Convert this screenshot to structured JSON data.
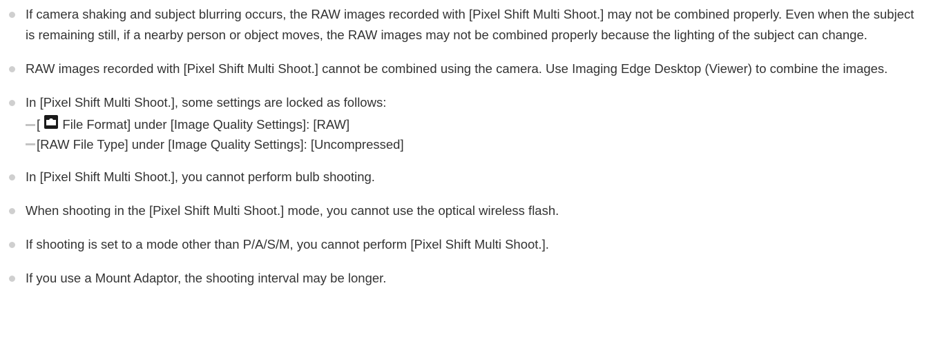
{
  "notes": [
    {
      "text": "If camera shaking and subject blurring occurs, the RAW images recorded with [Pixel Shift Multi Shoot.] may not be combined properly. Even when the subject is remaining still, if a nearby person or object moves, the RAW images may not be combined properly because the lighting of the subject can change."
    },
    {
      "text": "RAW images recorded with [Pixel Shift Multi Shoot.] cannot be combined using the camera. Use Imaging Edge Desktop (Viewer) to combine the images."
    },
    {
      "text": "In [Pixel Shift Multi Shoot.], some settings are locked as follows:",
      "subitems": [
        {
          "prefix": "[",
          "icon": "camera-icon",
          "text": "File Format] under [Image Quality Settings]: [RAW]"
        },
        {
          "text": "[RAW File Type] under [Image Quality Settings]: [Uncompressed]"
        }
      ]
    },
    {
      "text": "In [Pixel Shift Multi Shoot.], you cannot perform bulb shooting."
    },
    {
      "text": "When shooting in the [Pixel Shift Multi Shoot.] mode, you cannot use the optical wireless flash."
    },
    {
      "text": "If shooting is set to a mode other than P/A/S/M, you cannot perform [Pixel Shift Multi Shoot.]."
    },
    {
      "text": "If you use a Mount Adaptor, the shooting interval may be longer."
    }
  ],
  "colors": {
    "text": "#333333",
    "bullet": "#cfcfcf",
    "dash": "#c4c4c4",
    "icon_bg": "#1a1a1a"
  }
}
